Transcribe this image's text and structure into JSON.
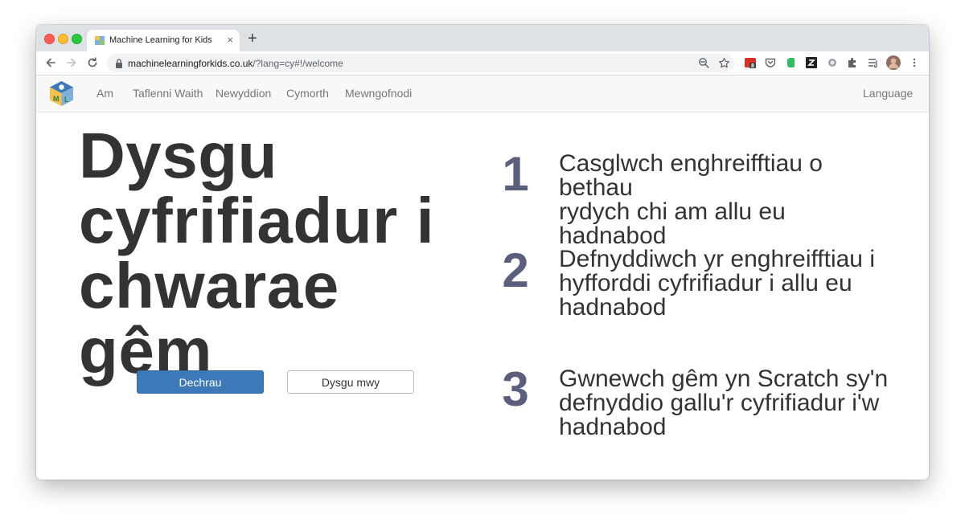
{
  "browser": {
    "tab_title": "Machine Learning for Kids",
    "new_tab_label": "+",
    "close_tab_label": "×",
    "url_host": "machinelearningforkids.co.uk",
    "url_path": "/?lang=cy#!/welcome"
  },
  "navbar": {
    "items": [
      {
        "label": "Am"
      },
      {
        "label": "Taflenni Waith"
      },
      {
        "label": "Newyddion"
      },
      {
        "label": "Cymorth"
      },
      {
        "label": "Mewngofnodi"
      }
    ],
    "language_label": "Language"
  },
  "hero": {
    "line1": "Dysgu",
    "line2": "cyfrifiadur i",
    "line3": "chwarae gêm",
    "start_button": "Dechrau",
    "learn_more_button": "Dysgu mwy"
  },
  "steps": [
    {
      "number": "1",
      "lines": [
        "Casglwch enghreifftiau o bethau",
        "rydych chi am allu eu hadnabod"
      ]
    },
    {
      "number": "2",
      "lines": [
        "Defnyddiwch yr enghreifftiau i",
        "hyfforddi cyfrifiadur i allu eu",
        "hadnabod"
      ]
    },
    {
      "number": "3",
      "lines": [
        "Gwnewch gêm yn Scratch sy'n",
        "defnyddio gallu'r cyfrifiadur i'w",
        "hadnabod"
      ]
    }
  ],
  "extensions": {
    "badge_count": "8"
  },
  "colors": {
    "primary_button": "#3d79b9",
    "step_number": "#5a5f7d",
    "headline": "#333333"
  }
}
